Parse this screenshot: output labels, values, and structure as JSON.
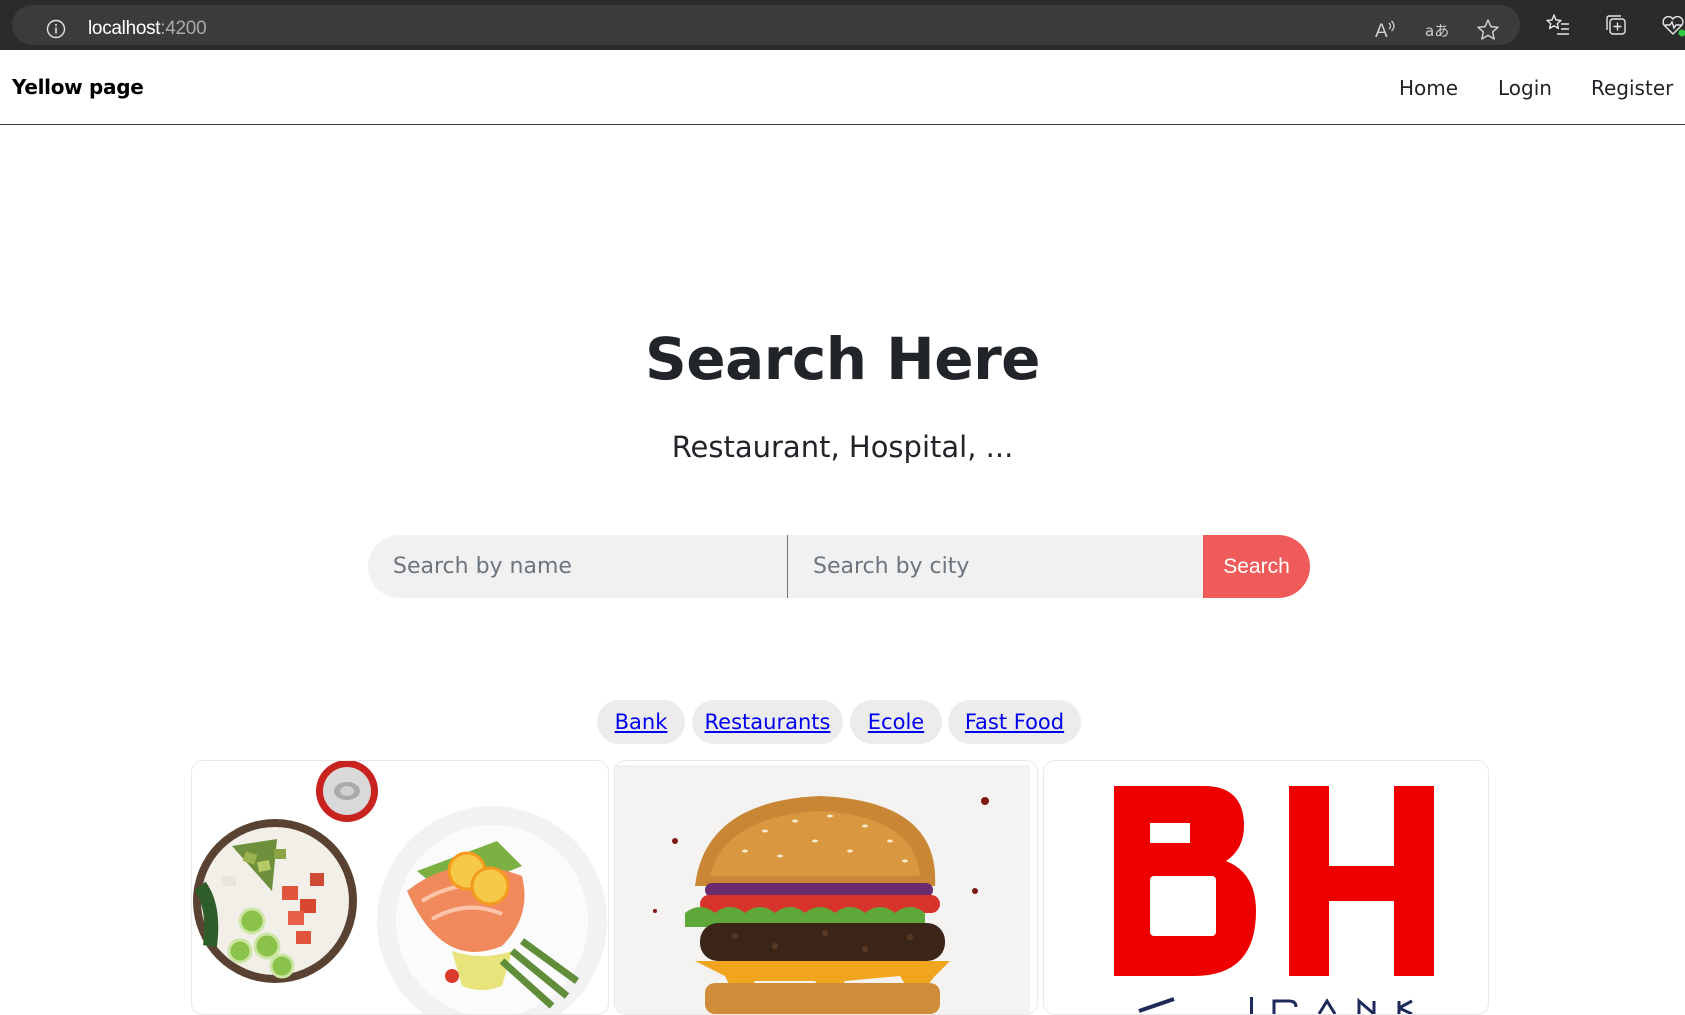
{
  "browser": {
    "url_host": "localhost",
    "url_port": ":4200"
  },
  "navbar": {
    "brand": "Yellow page",
    "links": [
      "Home",
      "Login",
      "Register"
    ]
  },
  "hero": {
    "title": "Search Here",
    "subtitle": "Restaurant, Hospital, ..."
  },
  "search": {
    "name_placeholder": "Search by name",
    "city_placeholder": "Search by city",
    "button_label": "Search"
  },
  "categories": [
    "Bank",
    "Restaurants",
    "Ecole",
    "Fast Food"
  ],
  "cards": [
    {
      "image": "healthy-food-bowls-photo"
    },
    {
      "image": "burger-photo"
    },
    {
      "image": "bh-bank-logo",
      "logo_text": "BH",
      "logo_subtext": "BANK"
    }
  ],
  "colors": {
    "search_button": "#ef5a5a",
    "logo_red": "#ee0000",
    "link_blue": "#0000ee"
  }
}
